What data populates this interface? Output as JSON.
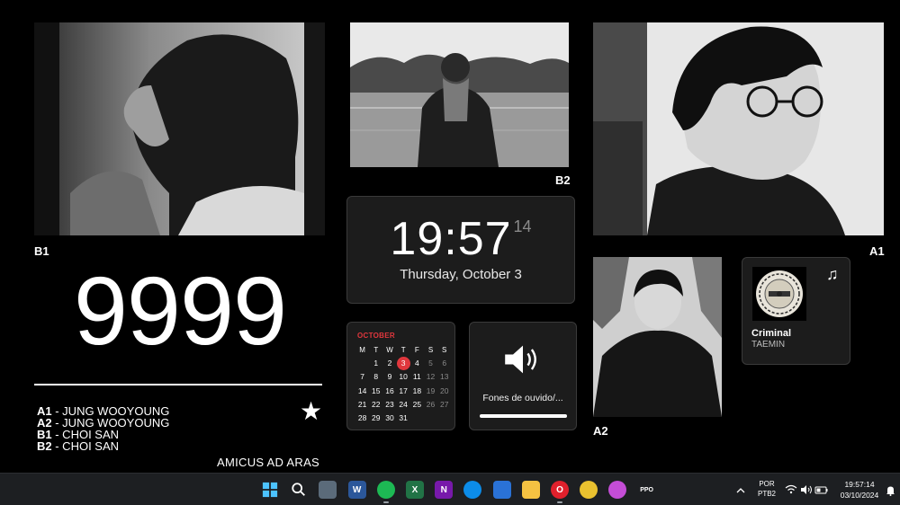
{
  "photos": {
    "b1": {
      "label": "B1",
      "alt": "side profile portrait near window"
    },
    "b2": {
      "label": "B2",
      "alt": "standing by a lake with scarf"
    },
    "a1": {
      "label": "A1",
      "alt": "profile with glasses"
    },
    "a2": {
      "label": "A2",
      "alt": "portrait in hoodie"
    }
  },
  "counter": "9999",
  "credits": [
    {
      "code": "A1",
      "name": " - JUNG WOOYOUNG"
    },
    {
      "code": "A2",
      "name": " - JUNG WOOYOUNG"
    },
    {
      "code": "B1",
      "name": " - CHOI SAN"
    },
    {
      "code": "B2",
      "name": " - CHOI SAN"
    }
  ],
  "star_glyph": "★",
  "motto": "AMICUS AD ARAS",
  "clock": {
    "hm": "19:57",
    "seconds": "14",
    "date": "Thursday, October 3"
  },
  "calendar": {
    "month": "OCTOBER",
    "weekdays": [
      "M",
      "T",
      "W",
      "T",
      "F",
      "S",
      "S"
    ],
    "weeks": [
      [
        {
          "d": "1"
        },
        {
          "d": "2"
        },
        {
          "d": "3",
          "today": true
        },
        {
          "d": "4"
        },
        {
          "d": "5",
          "dim": true
        },
        {
          "d": "6",
          "dim": true
        }
      ],
      [
        {
          "d": "7"
        },
        {
          "d": "8"
        },
        {
          "d": "9"
        },
        {
          "d": "10"
        },
        {
          "d": "11"
        },
        {
          "d": "12",
          "dim": true
        },
        {
          "d": "13",
          "dim": true
        }
      ],
      [
        {
          "d": "14"
        },
        {
          "d": "15"
        },
        {
          "d": "16"
        },
        {
          "d": "17"
        },
        {
          "d": "18"
        },
        {
          "d": "19",
          "dim": true
        },
        {
          "d": "20",
          "dim": true
        }
      ],
      [
        {
          "d": "21"
        },
        {
          "d": "22"
        },
        {
          "d": "23"
        },
        {
          "d": "24"
        },
        {
          "d": "25"
        },
        {
          "d": "26",
          "dim": true
        },
        {
          "d": "27",
          "dim": true
        }
      ],
      [
        {
          "d": "28"
        },
        {
          "d": "29"
        },
        {
          "d": "30"
        },
        {
          "d": "31"
        }
      ]
    ],
    "accent": "#e0373d"
  },
  "volume": {
    "device": "Fones de ouvido/...",
    "level_percent": 100
  },
  "music": {
    "title": "Criminal",
    "artist": "TAEMIN",
    "note_glyph": "♫"
  },
  "taskbar": {
    "apps": [
      {
        "name": "start-icon",
        "glyph": "",
        "color": "#1e90ff"
      },
      {
        "name": "search-icon",
        "glyph": "",
        "color": "transparent"
      },
      {
        "name": "widgets-icon",
        "glyph": "",
        "color": "#5b6b7a"
      },
      {
        "name": "word-icon",
        "glyph": "W",
        "color": "#2b579a"
      },
      {
        "name": "spotify-icon",
        "glyph": "",
        "color": "#1db954"
      },
      {
        "name": "excel-icon",
        "glyph": "X",
        "color": "#217346"
      },
      {
        "name": "onenote-icon",
        "glyph": "N",
        "color": "#7719aa"
      },
      {
        "name": "edge-icon",
        "glyph": "",
        "color": "#0c8ce9"
      },
      {
        "name": "store-icon",
        "glyph": "",
        "color": "#2a72d6"
      },
      {
        "name": "explorer-icon",
        "glyph": "",
        "color": "#f5c242"
      },
      {
        "name": "opera-icon",
        "glyph": "O",
        "color": "#e0202c"
      },
      {
        "name": "chrome-icon",
        "glyph": "",
        "color": "#e9c12f"
      },
      {
        "name": "paint-icon",
        "glyph": "",
        "color": "#c44dd6"
      },
      {
        "name": "app-icon",
        "glyph": "PPO",
        "color": "transparent"
      }
    ],
    "lang": "POR",
    "layout": "PTB2",
    "time": "19:57:14",
    "date": "03/10/2024"
  }
}
